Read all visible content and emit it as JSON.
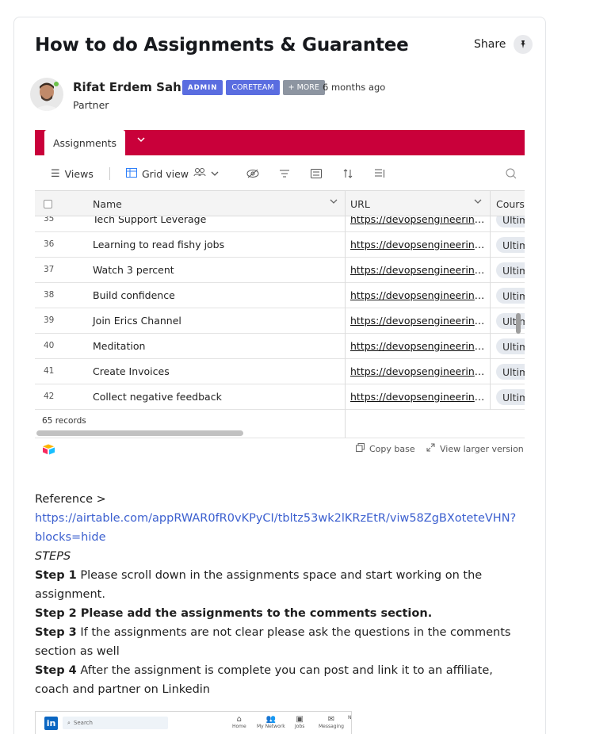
{
  "post": {
    "title": "How to do Assignments & Guarantee",
    "share_label": "Share",
    "author": "Rifat Erdem Sahin",
    "badges": [
      "ADMIN",
      "CORETEAM",
      "+ MORE"
    ],
    "time_ago": "6 months ago",
    "role": "Partner"
  },
  "airtable": {
    "tab_label": "Assignments",
    "toolbar": {
      "views": "Views",
      "grid_view": "Grid view"
    },
    "columns": {
      "name": "Name",
      "url": "URL",
      "course": "Course"
    },
    "rows": [
      {
        "num": "35",
        "name": "Tech Support Leverage",
        "url": "https://devopsengineering...",
        "course": "Ultim"
      },
      {
        "num": "36",
        "name": "Learning to read fishy jobs",
        "url": "https://devopsengineering...",
        "course": "Ultim"
      },
      {
        "num": "37",
        "name": "Watch 3 percent",
        "url": "https://devopsengineering...",
        "course": "Ultim"
      },
      {
        "num": "38",
        "name": "Build confidence",
        "url": "https://devopsengineering...",
        "course": "Ultim"
      },
      {
        "num": "39",
        "name": "Join Erics Channel",
        "url": "https://devopsengineering...",
        "course": "Ultim"
      },
      {
        "num": "40",
        "name": "Meditation",
        "url": "https://devopsengineering...",
        "course": "Ultim"
      },
      {
        "num": "41",
        "name": "Create Invoices",
        "url": "https://devopsengineering...",
        "course": "Ultim"
      },
      {
        "num": "42",
        "name": "Collect negative feedback",
        "url": "https://devopsengineering...",
        "course": "Ultim"
      }
    ],
    "records_count": "65 records",
    "copy_base": "Copy base",
    "view_larger": "View larger version",
    "brand_color": "#c9003a"
  },
  "content": {
    "reference_label": "Reference >",
    "reference_url": "https://airtable.com/appRWAR0fR0vKPyCI/tbltz53wk2lKRzEtR/viw58ZgBXoteteVHN?blocks=hide",
    "steps_label": "STEPS",
    "step1_label": "Step 1",
    "step1_text": " Please scroll down in the assignments space and start working on the assignment.",
    "step2_text": "Step 2 Please add the assignments to the comments section.",
    "step3_label": "Step 3",
    "step3_text": " If the assignments are not clear please ask the questions in the comments section as well",
    "step4_label": "Step 4",
    "step4_text": " After the assignment is complete you can post and link it to an affiliate, coach and partner on Linkedin"
  },
  "linkedin": {
    "logo": "in",
    "search_placeholder": "Search",
    "nav": [
      "Home",
      "My Network",
      "Jobs",
      "Messaging",
      "N"
    ]
  }
}
